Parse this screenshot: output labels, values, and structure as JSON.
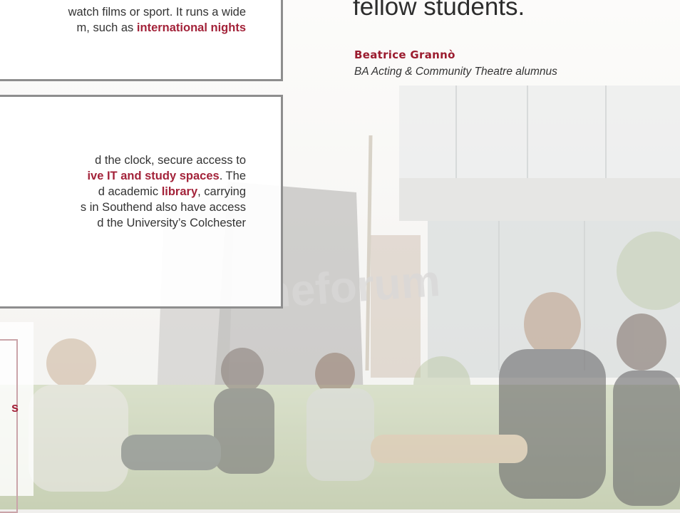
{
  "box1": {
    "lines": [
      {
        "parts": [
          {
            "t": "watch films or sport. It runs a wide",
            "hl": false
          }
        ]
      },
      {
        "parts": [
          {
            "t": "m, such as ",
            "hl": false
          },
          {
            "t": "international nights",
            "hl": true
          }
        ]
      }
    ]
  },
  "box2": {
    "lines": [
      {
        "parts": [
          {
            "t": "d the clock, secure access to",
            "hl": false
          }
        ]
      },
      {
        "parts": [
          {
            "t": "ive IT and study spaces",
            "hl": true
          },
          {
            "t": ". The",
            "hl": false
          }
        ]
      },
      {
        "parts": [
          {
            "t": "d academic ",
            "hl": false
          },
          {
            "t": "library",
            "hl": true
          },
          {
            "t": ", carrying",
            "hl": false
          }
        ]
      },
      {
        "parts": [
          {
            "t": "s in Southend also have access",
            "hl": false
          }
        ]
      },
      {
        "parts": [
          {
            "t": "d the University’s Colchester",
            "hl": false
          }
        ]
      }
    ]
  },
  "box3": {
    "fragment": "s"
  },
  "quote": {
    "text_end": "fellow students.",
    "author": "Beatrice Grannò",
    "role": "BA Acting & Community Theatre alumnus"
  },
  "photo": {
    "building_sign": "theforum"
  },
  "colors": {
    "accent": "#a3233a",
    "border": "#8e8e8e"
  }
}
